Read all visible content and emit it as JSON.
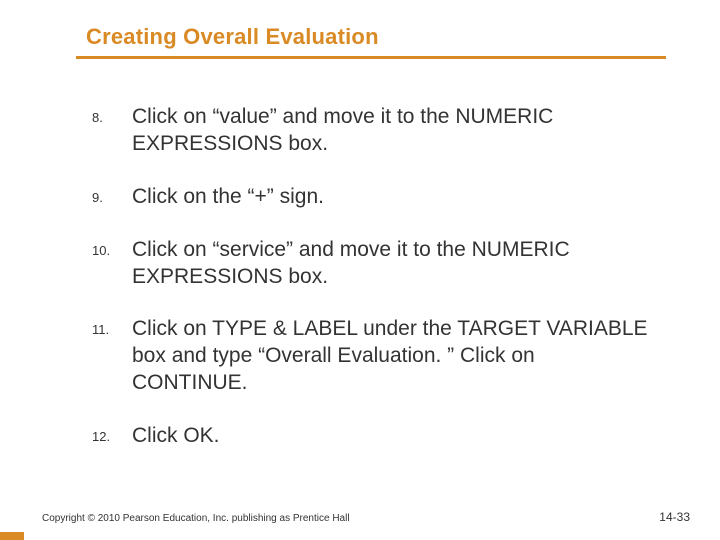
{
  "title": "Creating Overall Evaluation",
  "list": {
    "start": 8,
    "items": [
      {
        "num": "8.",
        "text": "Click on “value” and move it to the NUMERIC EXPRESSIONS box."
      },
      {
        "num": "9.",
        "text": "Click on the “+” sign."
      },
      {
        "num": "10.",
        "text": "Click on “service” and move it to the NUMERIC EXPRESSIONS box."
      },
      {
        "num": "11.",
        "text": "Click on TYPE & LABEL under the TARGET VARIABLE box and type “Overall Evaluation. ”  Click on CONTINUE."
      },
      {
        "num": "12.",
        "text": "Click OK."
      }
    ]
  },
  "footer": {
    "copyright": "Copyright © 2010 Pearson Education, Inc. publishing as Prentice Hall",
    "pagenum": "14-33"
  },
  "colors": {
    "accent": "#d98a24"
  }
}
